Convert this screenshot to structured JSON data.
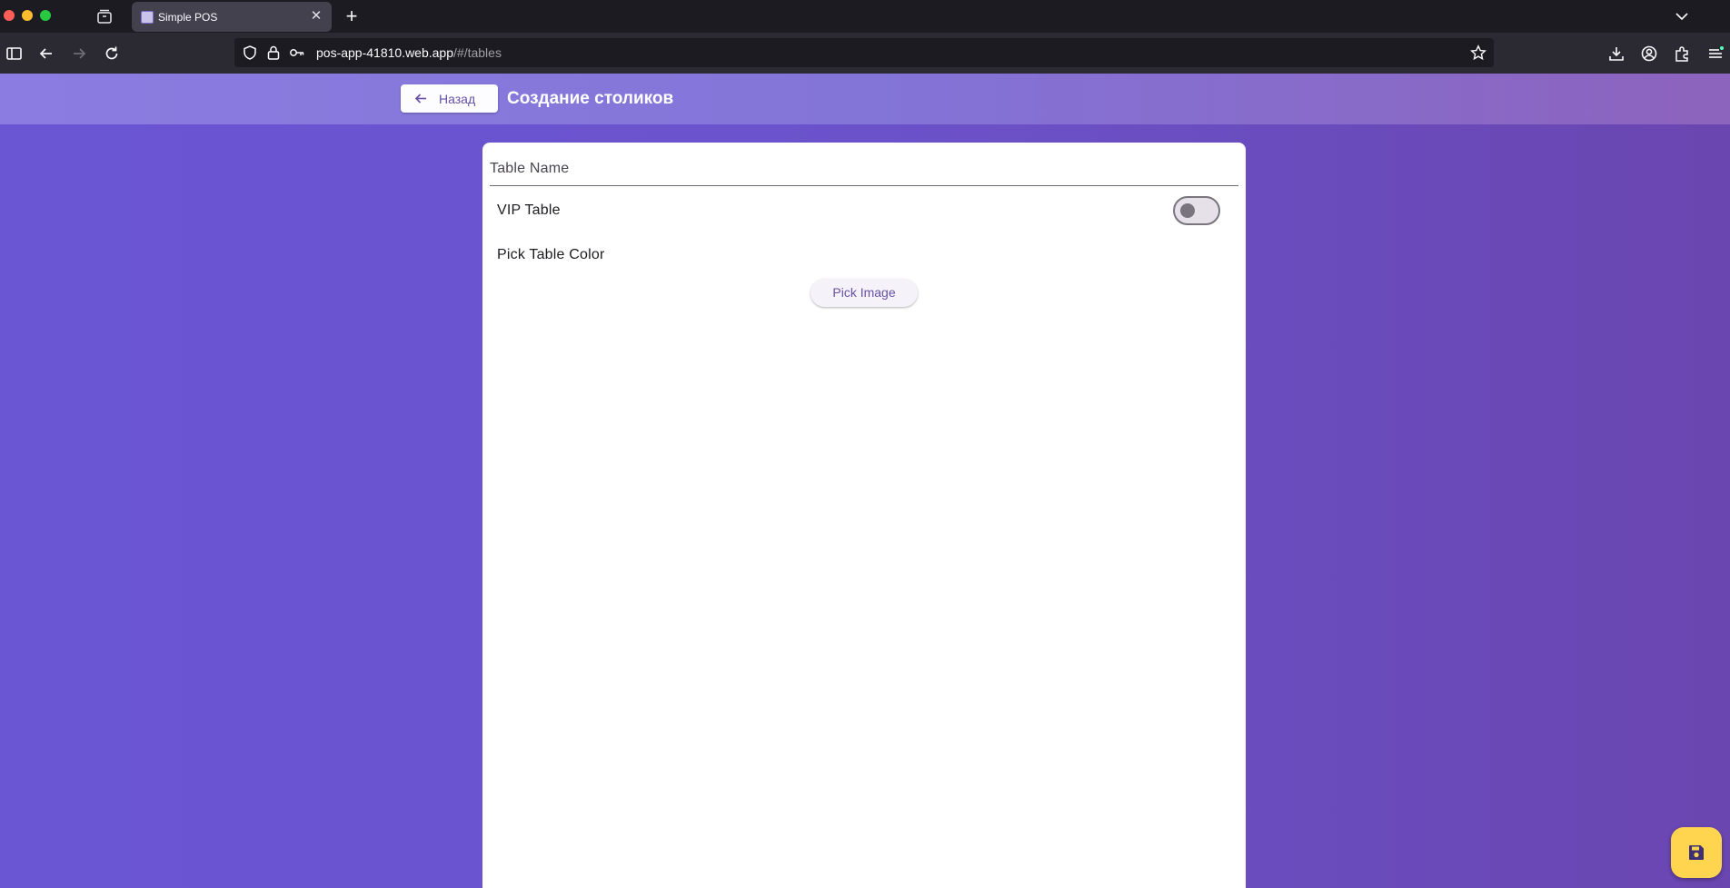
{
  "browser": {
    "tab": {
      "title": "Simple POS"
    },
    "url": {
      "host": "pos-app-41810.web.app",
      "path": "/#/tables"
    }
  },
  "app": {
    "back_label": "Назад",
    "title": "Создание столиков",
    "form": {
      "table_name_placeholder": "Table Name",
      "vip_label": "VIP Table",
      "vip_enabled": false,
      "color_label": "Pick Table Color",
      "pick_image_label": "Pick Image"
    },
    "fab_icon": "save-icon"
  },
  "colors": {
    "primary": "#6750a4",
    "fab": "#ffd54f",
    "background_start": "#6a55d3",
    "background_end": "#6a46b0"
  }
}
